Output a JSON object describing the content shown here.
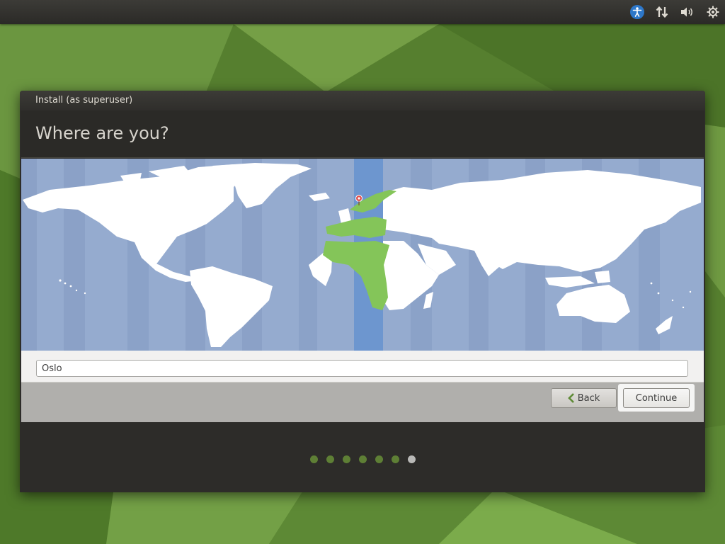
{
  "panel": {
    "icons": [
      "accessibility-icon",
      "network-icon",
      "volume-icon",
      "settings-icon"
    ]
  },
  "window": {
    "title": "Install (as superuser)",
    "heading": "Where are you?",
    "location": {
      "value": "Oslo",
      "placeholder": ""
    },
    "buttons": {
      "back_label": "Back",
      "continue_label": "Continue"
    },
    "progress": {
      "total_steps": 7,
      "current_step": 7
    }
  },
  "colors": {
    "selected_timezone_band": "#6d96cf",
    "selected_region": "#84c559",
    "map_water": "#95abcf",
    "land": "#ffffff",
    "pin": "#e0504e",
    "progress_dot": "#5e7f35",
    "progress_dot_active": "#b9b9b7",
    "desktop_accent": "#5e8a35"
  }
}
